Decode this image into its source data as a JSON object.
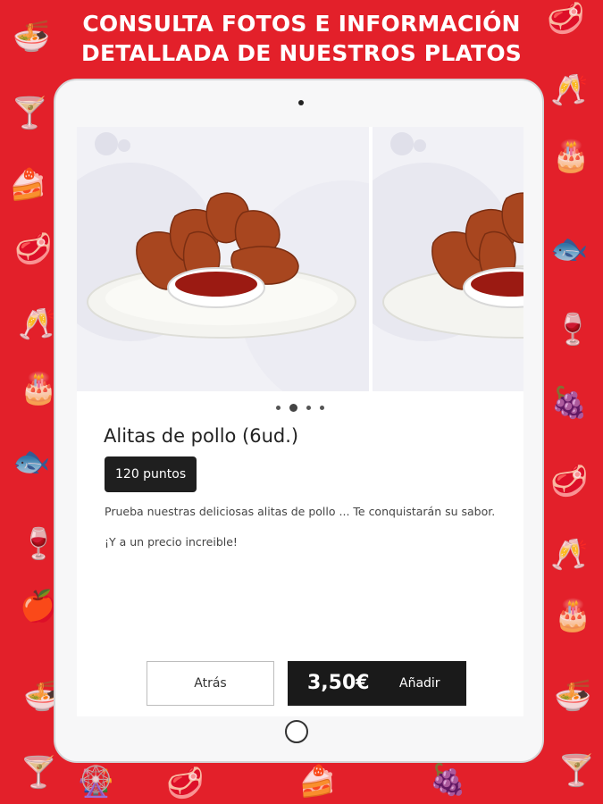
{
  "banner": {
    "line1": "CONSULTA FOTOS E INFORMACIÓN",
    "line2": "DETALLADA DE NUESTROS PLATOS"
  },
  "background_icons": [
    "noodles-icon",
    "cocktail-icon",
    "cake-slice-icon",
    "steak-icon",
    "wine-glasses-icon",
    "birthday-cake-icon",
    "fish-icon",
    "wine-bottle-icon",
    "fruit-icon",
    "bicycle-wheel-icon"
  ],
  "product": {
    "name": "Alitas de pollo (6ud.)",
    "points": "120 puntos",
    "description_1": "Prueba nuestras deliciosas alitas de pollo ... Te conquistarán su sabor.",
    "description_2": "¡Y a un precio increible!",
    "image": "chicken-wings-photo"
  },
  "gallery": {
    "page_count": 4,
    "active_index": 1
  },
  "actions": {
    "back_label": "Atrás",
    "price": "3,50€",
    "add_label": "Añadir"
  },
  "colors": {
    "background": "#e3202a",
    "icon_pattern": "#f37a80",
    "button_dark": "#1a1a1a"
  }
}
